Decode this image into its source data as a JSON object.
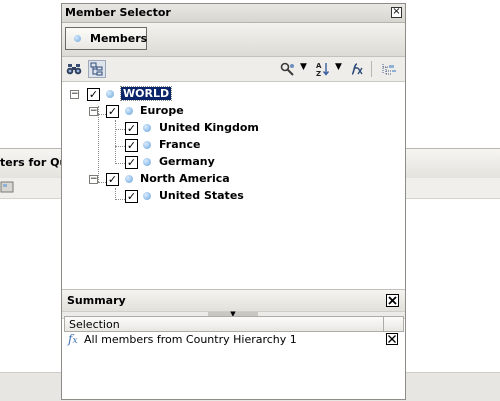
{
  "background": {
    "panel_title": "ters for Qu"
  },
  "dialog": {
    "title": "Member Selector",
    "close_glyph": "×"
  },
  "tabs": [
    {
      "label": "Members",
      "selected": true
    }
  ],
  "toolbar": {
    "buttons": [
      {
        "name": "find-icon"
      },
      {
        "name": "hierarchy-view-icon",
        "pressed": true
      },
      {
        "name": "tools-icon"
      },
      {
        "name": "sort-icon"
      },
      {
        "name": "formula-icon"
      },
      {
        "name": "expand-all-icon"
      }
    ]
  },
  "tree": {
    "nodes": [
      {
        "label": "WORLD",
        "level": 0,
        "checked": true,
        "expanded": true,
        "selected": true
      },
      {
        "label": "Europe",
        "level": 1,
        "checked": true,
        "expanded": true
      },
      {
        "label": "United Kingdom",
        "level": 2,
        "checked": true
      },
      {
        "label": "France",
        "level": 2,
        "checked": true
      },
      {
        "label": "Germany",
        "level": 2,
        "checked": true
      },
      {
        "label": "North America",
        "level": 1,
        "checked": true,
        "expanded": true
      },
      {
        "label": "United States",
        "level": 2,
        "checked": true
      }
    ]
  },
  "summary": {
    "title": "Summary",
    "column_header": "Selection",
    "rows": [
      {
        "text": "All members from Country Hierarchy 1"
      }
    ]
  }
}
